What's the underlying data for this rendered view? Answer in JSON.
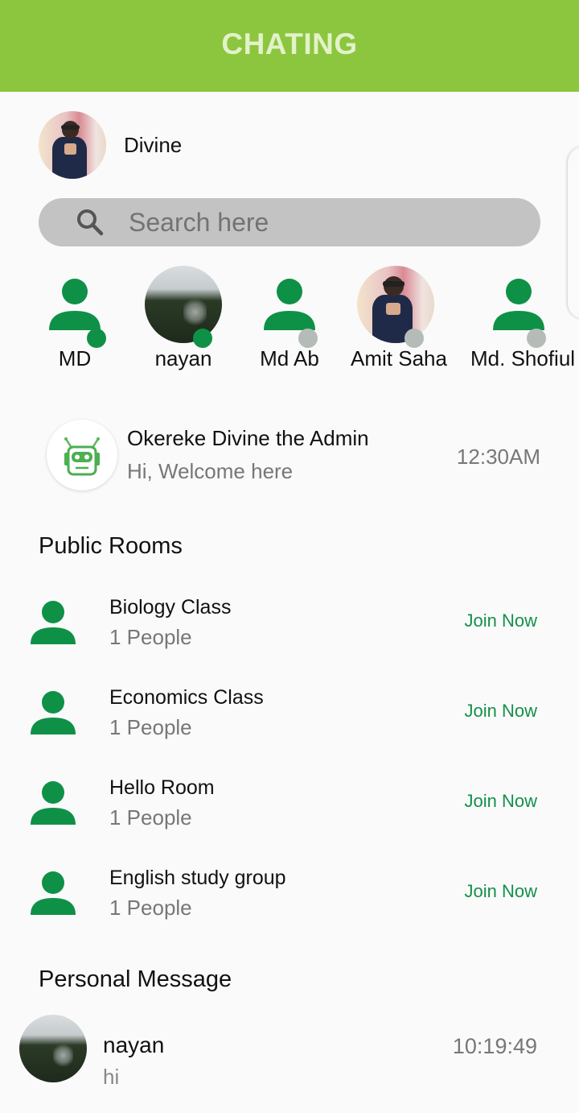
{
  "appbar": {
    "title": "CHATING"
  },
  "colors": {
    "appbar_bg": "#8cc63f",
    "appbar_title": "#e3f2c8",
    "accent_green": "#14904a",
    "online": "#0e9147",
    "offline": "#b5bcb7",
    "search_bg": "#c3c3c3"
  },
  "profile": {
    "name": "Divine",
    "avatar": "user-photo"
  },
  "search": {
    "placeholder": "Search here",
    "value": "",
    "icon": "search-icon"
  },
  "contacts": [
    {
      "name": "MD",
      "avatar": "default-person-icon",
      "status": "online"
    },
    {
      "name": "nayan",
      "avatar": "tree-photo",
      "status": "online"
    },
    {
      "name": "Md Ab",
      "avatar": "default-person-icon",
      "status": "offline"
    },
    {
      "name": "Amit Saha",
      "avatar": "user-photo",
      "status": "offline"
    },
    {
      "name": "Md. Shofiul",
      "avatar": "default-person-icon",
      "status": "offline"
    }
  ],
  "admin_chat": {
    "name": "Okereke Divine the Admin",
    "message": "Hi, Welcome here",
    "time": "12:30AM",
    "icon": "robot-icon"
  },
  "public_rooms": {
    "title": "Public Rooms",
    "rooms": [
      {
        "name": "Biology Class",
        "count": "1 People",
        "action": "Join Now"
      },
      {
        "name": "Economics Class",
        "count": "1 People",
        "action": "Join Now"
      },
      {
        "name": "Hello Room",
        "count": "1 People",
        "action": "Join Now"
      },
      {
        "name": "English study group",
        "count": "1 People",
        "action": "Join Now"
      }
    ]
  },
  "personal_messages": {
    "title": "Personal Message",
    "items": [
      {
        "name": "nayan",
        "message": "hi",
        "time": "10:19:49",
        "avatar": "tree-photo"
      }
    ]
  }
}
